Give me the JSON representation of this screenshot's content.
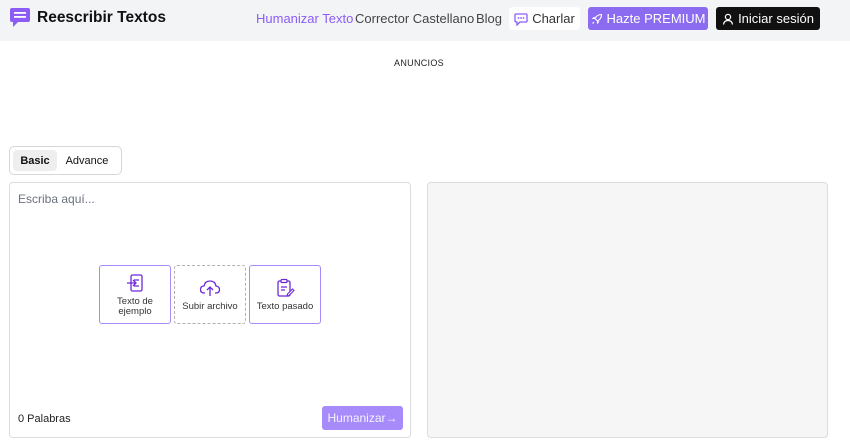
{
  "brand": {
    "name": "Reescribir Textos",
    "icon": "chat-bubble-icon"
  },
  "nav": {
    "humanize": "Humanizar Texto",
    "corrector": "Corrector Castellano",
    "blog": "Blog"
  },
  "buttons": {
    "chat": "Charlar",
    "premium": "Hazte PREMIUM",
    "login": "Iniciar sesión"
  },
  "ads_label": "ANUNCIOS",
  "mode_tabs": {
    "basic": "Basic",
    "advance": "Advance",
    "selected": "Basic"
  },
  "editor": {
    "placeholder": "Escriba aquí...",
    "cards": {
      "example": "Texto de ejemplo",
      "upload": "Subir archivo",
      "paste": "Texto pasado"
    },
    "word_count": "0 Palabras",
    "humanize_button": "Humanizar→"
  },
  "colors": {
    "accent": "#8b5cf6",
    "premium_bg": "#8b6cf0",
    "humanize_bg": "#a78bfa",
    "topbar_bg": "#f3f4f6",
    "login_bg": "#111111"
  }
}
